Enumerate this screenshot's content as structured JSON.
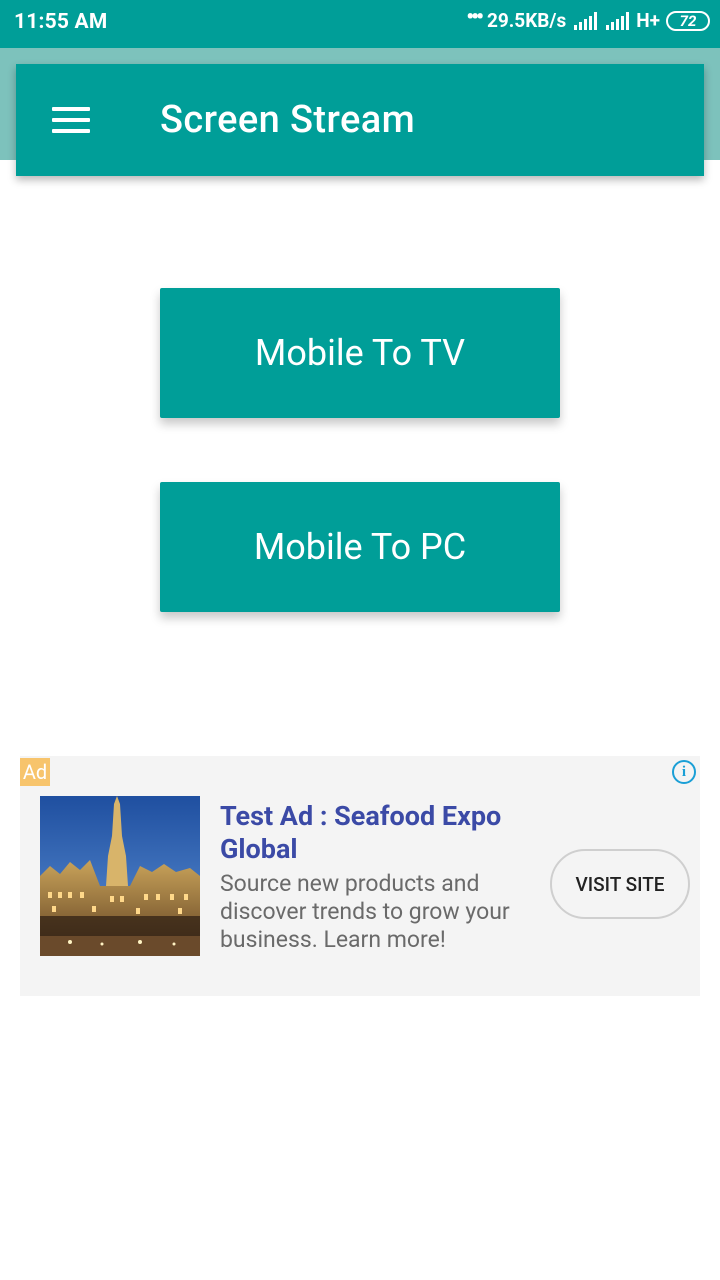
{
  "status_bar": {
    "time": "11:55 AM",
    "network_speed": "29.5KB/s",
    "network_type": "H+",
    "battery": "72"
  },
  "app_bar": {
    "title": "Screen Stream",
    "menu_icon": "hamburger-menu-icon"
  },
  "main": {
    "buttons": [
      {
        "label": "Mobile To TV"
      },
      {
        "label": "Mobile To PC"
      }
    ]
  },
  "ad": {
    "badge": "Ad",
    "info_icon": "info-icon",
    "title": "Test Ad : Seafood Expo Global",
    "body": "Source new products and discover trends to grow your business. Learn more!",
    "cta": "VISIT SITE"
  },
  "colors": {
    "primary": "#009e98",
    "header_band": "#7dc2bc",
    "ad_title": "#3b4aa6",
    "ad_badge": "#f7c46c"
  }
}
